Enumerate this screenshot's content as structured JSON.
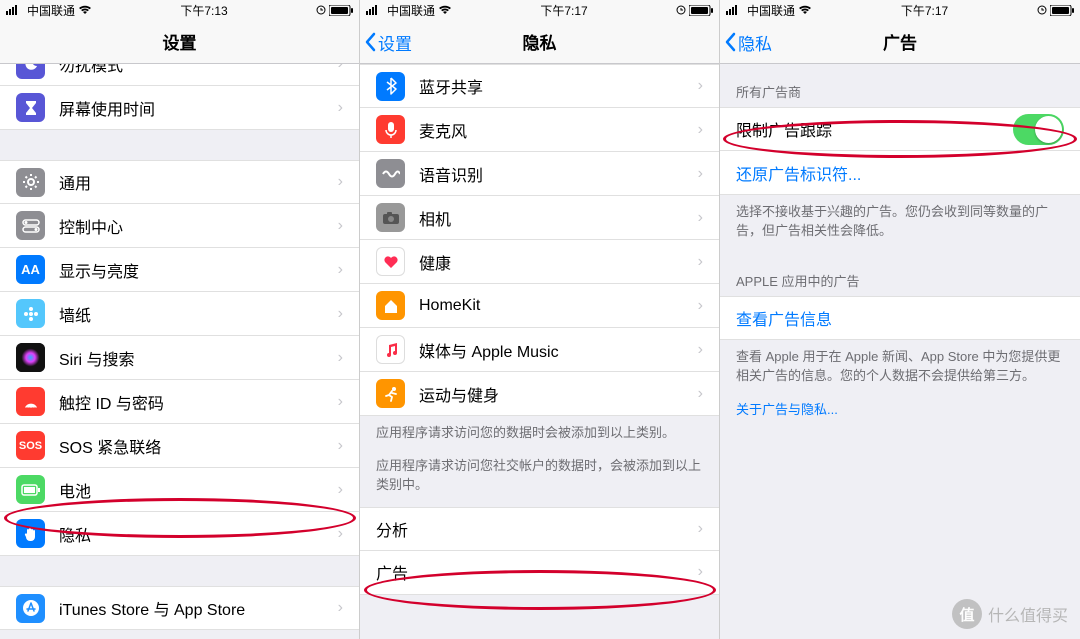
{
  "status": {
    "carrier": "中国联通"
  },
  "pane1": {
    "time": "下午7:13",
    "title": "设置",
    "rows": [
      {
        "icon": {
          "bg": "#5856D6",
          "glyph": "moon"
        },
        "label": "勿扰模式"
      },
      {
        "icon": {
          "bg": "#5856D6",
          "glyph": "hourglass"
        },
        "label": "屏幕使用时间"
      }
    ],
    "rows2": [
      {
        "icon": {
          "bg": "#8E8E93",
          "glyph": "gear"
        },
        "label": "通用"
      },
      {
        "icon": {
          "bg": "#8E8E93",
          "glyph": "switches"
        },
        "label": "控制中心"
      },
      {
        "icon": {
          "bg": "#007AFF",
          "glyph": "AA"
        },
        "label": "显示与亮度"
      },
      {
        "icon": {
          "bg": "#54C7FC",
          "glyph": "flower"
        },
        "label": "墙纸"
      },
      {
        "icon": {
          "bg": "#111",
          "glyph": "siri"
        },
        "label": "Siri 与搜索"
      },
      {
        "icon": {
          "bg": "#FF3B30",
          "glyph": "touchid"
        },
        "label": "触控 ID 与密码"
      },
      {
        "icon": {
          "bg": "#FF3B30",
          "glyph": "SOS"
        },
        "label": "SOS 紧急联络"
      },
      {
        "icon": {
          "bg": "#4CD964",
          "glyph": "battery"
        },
        "label": "电池"
      },
      {
        "icon": {
          "bg": "#007AFF",
          "glyph": "hand"
        },
        "label": "隐私"
      }
    ],
    "rows3": [
      {
        "icon": {
          "bg": "#1F8FFF",
          "glyph": "appstore"
        },
        "label": "iTunes Store 与 App Store"
      }
    ]
  },
  "pane2": {
    "time": "下午7:17",
    "back": "设置",
    "title": "隐私",
    "rows": [
      {
        "icon": {
          "bg": "#007AFF",
          "glyph": "bt"
        },
        "label": "蓝牙共享"
      },
      {
        "icon": {
          "bg": "#FF3B30",
          "glyph": "mic"
        },
        "label": "麦克风"
      },
      {
        "icon": {
          "bg": "#8E8E93",
          "glyph": "wave"
        },
        "label": "语音识别"
      },
      {
        "icon": {
          "bg": "#999",
          "glyph": "camera"
        },
        "label": "相机"
      },
      {
        "icon": {
          "bg": "#fff",
          "glyph": "heart",
          "fg": "#FF2D55",
          "border": true
        },
        "label": "健康"
      },
      {
        "icon": {
          "bg": "#FF9500",
          "glyph": "home"
        },
        "label": "HomeKit"
      },
      {
        "icon": {
          "bg": "#fff",
          "glyph": "music",
          "border": true
        },
        "label": "媒体与 Apple Music"
      },
      {
        "icon": {
          "bg": "#FF9500",
          "glyph": "run"
        },
        "label": "运动与健身"
      }
    ],
    "footer1": "应用程序请求访问您的数据时会被添加到以上类别。",
    "footer2": "应用程序请求访问您社交帐户的数据时，会被添加到以上类别中。",
    "rows2": [
      {
        "label": "分析"
      },
      {
        "label": "广告"
      }
    ]
  },
  "pane3": {
    "time": "下午7:17",
    "back": "隐私",
    "title": "广告",
    "header1": "所有广告商",
    "toggle_label": "限制广告跟踪",
    "reset_link": "还原广告标识符...",
    "footer1": "选择不接收基于兴趣的广告。您仍会收到同等数量的广告，但广告相关性会降低。",
    "header2": "APPLE 应用中的广告",
    "view_info": "查看广告信息",
    "footer2": "查看 Apple 用于在 Apple 新闻、App Store 中为您提供更相关广告的信息。您的个人数据不会提供给第三方。",
    "about_link": "关于广告与隐私..."
  },
  "watermark": "什么值得买"
}
